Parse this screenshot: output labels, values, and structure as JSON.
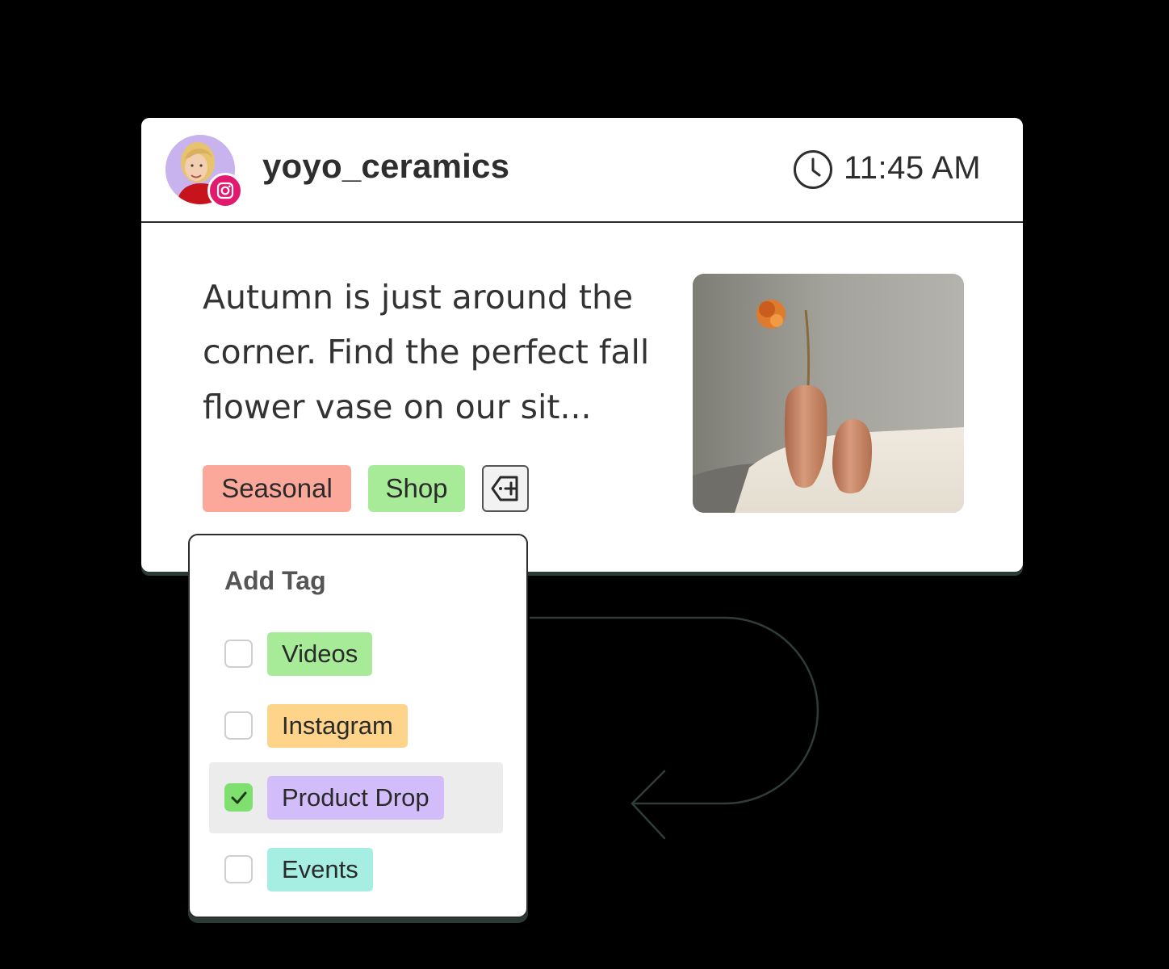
{
  "post": {
    "username": "yoyo_ceramics",
    "time": "11:45 AM",
    "caption": "Autumn is just around the corner. Find the perfect fall flower vase on our sit...",
    "tags": [
      {
        "label": "Seasonal",
        "color": "#fba89a"
      },
      {
        "label": "Shop",
        "color": "#a7eb98"
      }
    ],
    "add_tag_icon": "tag-plus-icon",
    "network_icon": "instagram-icon"
  },
  "dropdown": {
    "title": "Add Tag",
    "options": [
      {
        "label": "Videos",
        "color": "#a7eb98",
        "checked": false
      },
      {
        "label": "Instagram",
        "color": "#fdd48a",
        "checked": false
      },
      {
        "label": "Product Drop",
        "color": "#d2bdfa",
        "checked": true
      },
      {
        "label": "Events",
        "color": "#a6eee2",
        "checked": false
      }
    ]
  },
  "colors": {
    "background": "#000000",
    "card": "#ffffff",
    "check_green": "#7fe070",
    "instagram_pink": "#e3186f"
  }
}
